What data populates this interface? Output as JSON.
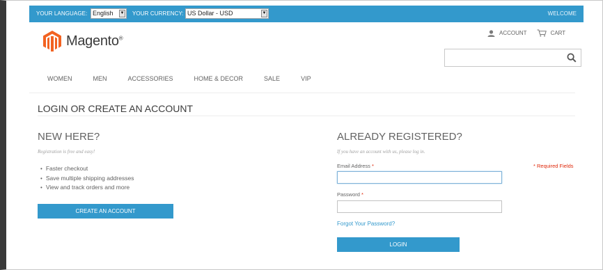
{
  "topbar": {
    "language_label": "YOUR LANGUAGE:",
    "language_value": "English",
    "currency_label": "YOUR CURRENCY:",
    "currency_value": "US Dollar - USD",
    "welcome": "WELCOME"
  },
  "header": {
    "logo_text": "Magento",
    "logo_reg": "®",
    "account_link": "ACCOUNT",
    "cart_link": "CART"
  },
  "nav": {
    "items": [
      "WOMEN",
      "MEN",
      "ACCESSORIES",
      "HOME & DECOR",
      "SALE",
      "VIP"
    ]
  },
  "page": {
    "title": "LOGIN OR CREATE AN ACCOUNT"
  },
  "new_customer": {
    "heading": "NEW HERE?",
    "note": "Registration is free and easy!",
    "benefits": [
      "Faster checkout",
      "Save multiple shipping addresses",
      "View and track orders and more"
    ],
    "create_button": "CREATE AN ACCOUNT"
  },
  "login": {
    "heading": "ALREADY REGISTERED?",
    "note": "If you have an account with us, please log in.",
    "email_label": "Email Address",
    "password_label": "Password",
    "required_marker": "*",
    "required_fields": "* Required Fields",
    "forgot_link": "Forgot Your Password?",
    "login_button": "LOGIN"
  },
  "colors": {
    "accent": "#3399cc",
    "required": "#df280a",
    "logo_orange": "#f26322"
  }
}
